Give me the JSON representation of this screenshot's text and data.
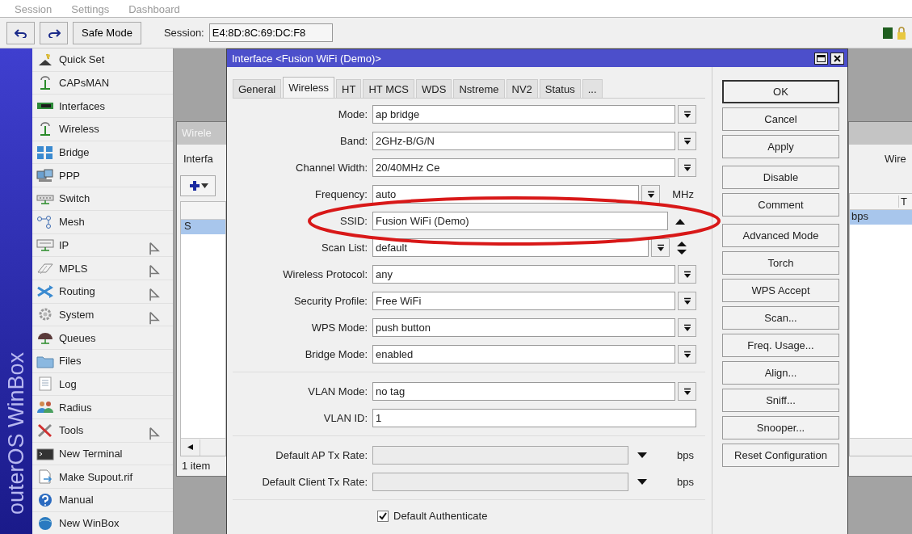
{
  "menu_bar": [
    "Session",
    "Settings",
    "Dashboard"
  ],
  "toolbar": {
    "safe_mode": "Safe Mode",
    "session_label": "Session:",
    "session_value": "E4:8D:8C:69:DC:F8"
  },
  "sidebar": {
    "brand": "outerOS WinBox",
    "items": [
      {
        "label": "Quick Set",
        "submenu": false
      },
      {
        "label": "CAPsMAN",
        "submenu": false
      },
      {
        "label": "Interfaces",
        "submenu": false
      },
      {
        "label": "Wireless",
        "submenu": false
      },
      {
        "label": "Bridge",
        "submenu": false
      },
      {
        "label": "PPP",
        "submenu": false
      },
      {
        "label": "Switch",
        "submenu": false
      },
      {
        "label": "Mesh",
        "submenu": false
      },
      {
        "label": "IP",
        "submenu": true
      },
      {
        "label": "MPLS",
        "submenu": true
      },
      {
        "label": "Routing",
        "submenu": true
      },
      {
        "label": "System",
        "submenu": true
      },
      {
        "label": "Queues",
        "submenu": false
      },
      {
        "label": "Files",
        "submenu": false
      },
      {
        "label": "Log",
        "submenu": false
      },
      {
        "label": "Radius",
        "submenu": false
      },
      {
        "label": "Tools",
        "submenu": true
      },
      {
        "label": "New Terminal",
        "submenu": false
      },
      {
        "label": "Make Supout.rif",
        "submenu": false
      },
      {
        "label": "Manual",
        "submenu": false
      },
      {
        "label": "New WinBox",
        "submenu": false
      }
    ]
  },
  "background_window": {
    "title": "Wirele",
    "tab": "Interfa",
    "row_flag": "S",
    "row_selected": true,
    "status": "1 item",
    "right_tab": "Wire",
    "right_column": "T",
    "right_cell": "bps"
  },
  "dialog": {
    "title": "Interface <Fusion WiFi (Demo)>",
    "tabs": [
      {
        "label": "General",
        "selected": false
      },
      {
        "label": "Wireless",
        "selected": true
      },
      {
        "label": "HT",
        "selected": false
      },
      {
        "label": "HT MCS",
        "selected": false
      },
      {
        "label": "WDS",
        "selected": false
      },
      {
        "label": "Nstreme",
        "selected": false
      },
      {
        "label": "NV2",
        "selected": false
      },
      {
        "label": "Status",
        "selected": false
      },
      {
        "label": "...",
        "selected": false
      }
    ],
    "groups": [
      [
        {
          "kind": "dropdown",
          "label": "Mode:",
          "value": "ap bridge",
          "disabled": false
        },
        {
          "kind": "dropdown",
          "label": "Band:",
          "value": "2GHz-B/G/N",
          "disabled": false
        },
        {
          "kind": "dropdown",
          "label": "Channel Width:",
          "value": "20/40MHz Ce",
          "disabled": false
        },
        {
          "kind": "dropdown",
          "label": "Frequency:",
          "value": "auto",
          "unit": "MHz",
          "disabled": false
        },
        {
          "kind": "toggle",
          "label": "SSID:",
          "value": "Fusion WiFi (Demo)",
          "disabled": false,
          "circled": true
        },
        {
          "kind": "reorder",
          "label": "Scan List:",
          "value": "default",
          "disabled": false
        },
        {
          "kind": "dropdown",
          "label": "Wireless Protocol:",
          "value": "any",
          "disabled": false
        },
        {
          "kind": "dropdown",
          "label": "Security Profile:",
          "value": "Free WiFi",
          "disabled": false
        },
        {
          "kind": "dropdown",
          "label": "WPS Mode:",
          "value": "push button",
          "disabled": false
        },
        {
          "kind": "dropdown",
          "label": "Bridge Mode:",
          "value": "enabled",
          "disabled": false
        }
      ],
      [
        {
          "kind": "dropdown",
          "label": "VLAN Mode:",
          "value": "no tag",
          "disabled": false
        },
        {
          "kind": "text",
          "label": "VLAN ID:",
          "value": "1",
          "disabled": false
        }
      ],
      [
        {
          "kind": "rate",
          "label": "Default AP Tx Rate:",
          "unit": "bps",
          "disabled": true
        },
        {
          "kind": "rate",
          "label": "Default Client Tx Rate:",
          "unit": "bps",
          "disabled": true
        }
      ],
      [
        {
          "kind": "checkbox",
          "label": "Default Authenticate",
          "checked": true
        }
      ]
    ],
    "button_groups": [
      [
        {
          "label": "OK",
          "default": true
        },
        {
          "label": "Cancel",
          "default": false
        },
        {
          "label": "Apply",
          "default": false
        }
      ],
      [
        {
          "label": "Disable",
          "default": false
        },
        {
          "label": "Comment",
          "default": false
        }
      ],
      [
        {
          "label": "Advanced Mode",
          "default": false
        },
        {
          "label": "Torch",
          "default": false
        },
        {
          "label": "WPS Accept",
          "default": false
        },
        {
          "label": "Scan...",
          "default": false
        },
        {
          "label": "Freq. Usage...",
          "default": false
        },
        {
          "label": "Align...",
          "default": false
        },
        {
          "label": "Sniff...",
          "default": false
        },
        {
          "label": "Snooper...",
          "default": false
        },
        {
          "label": "Reset Configuration",
          "default": false
        }
      ]
    ]
  },
  "annotation": {
    "kind": "ellipse"
  }
}
